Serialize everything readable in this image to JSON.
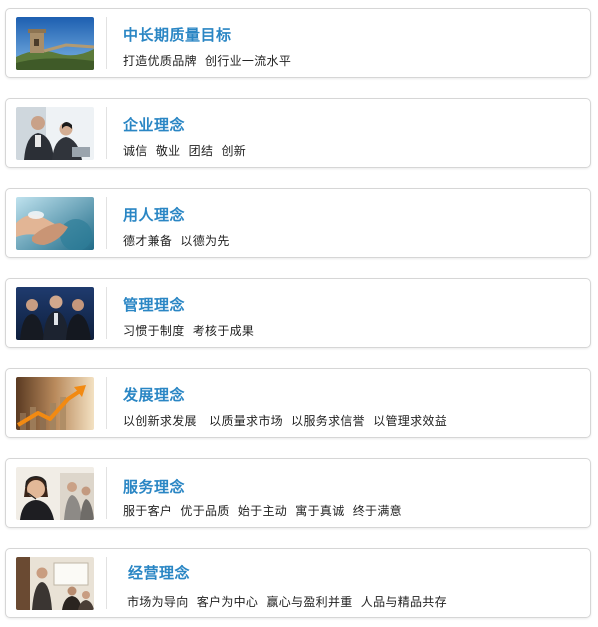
{
  "items": [
    {
      "title": "中长期质量目标",
      "desc": "打造优质品牌  创行业一流水平",
      "image": "great-wall-photo"
    },
    {
      "title": "企业理念",
      "desc": "诚信  敬业  团结  创新",
      "image": "business-people-photo"
    },
    {
      "title": "用人理念",
      "desc": "德才兼备  以德为先",
      "image": "handshake-photo"
    },
    {
      "title": "管理理念",
      "desc": "习惯于制度  考核于成果",
      "image": "business-team-photo"
    },
    {
      "title": "发展理念",
      "desc": "以创新求发展   以质量求市场  以服务求信誉  以管理求效益",
      "image": "growth-arrow-photo"
    },
    {
      "title": "服务理念",
      "desc": "服于客户  优于品质  始于主动  寓于真诚  终于满意",
      "image": "call-center-photo"
    },
    {
      "title": "经营理念",
      "desc": "市场为导向  客户为中心  赢心与盈利并重  人品与精品共存",
      "image": "business-meeting-photo"
    }
  ],
  "colors": {
    "title": "#2a86c4",
    "text": "#222222",
    "border": "#d6d6d6"
  }
}
